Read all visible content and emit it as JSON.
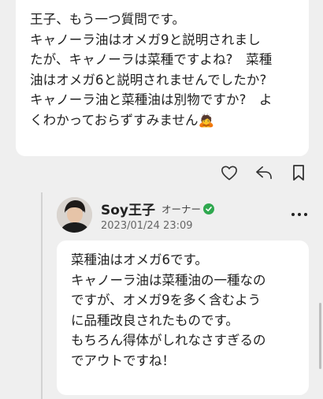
{
  "question": {
    "text": "王子、もう一つ質問です。\nキャノーラ油はオメガ9と説明されまし\nたが、キャノーラは菜種ですよね?　菜種\n油はオメガ6と説明されませんでしたか?\nキャノーラ油と菜種油は別物ですか?　よ\nくわかっておらずすみません🙇"
  },
  "actions": [
    {
      "name": "like-button",
      "icon": "heart-icon"
    },
    {
      "name": "reply-button",
      "icon": "reply-arrow-icon"
    },
    {
      "name": "bookmark-button",
      "icon": "bookmark-icon"
    }
  ],
  "reply": {
    "author": "Soy王子",
    "badge": "オーナー",
    "timestamp": "2023/01/24 23:09",
    "text": "菜種油はオメガ6です。\nキャノーラ油は菜種油の一種なの\nですが、オメガ9を多く含むよう\nに品種改良されたものです。\nもちろん得体がしれなさすぎるの\nでアウトですね！"
  },
  "colors": {
    "background": "#efefef",
    "bubble": "#ffffff",
    "verified": "#2fa84f",
    "text": "#222222",
    "muted": "#666666"
  }
}
